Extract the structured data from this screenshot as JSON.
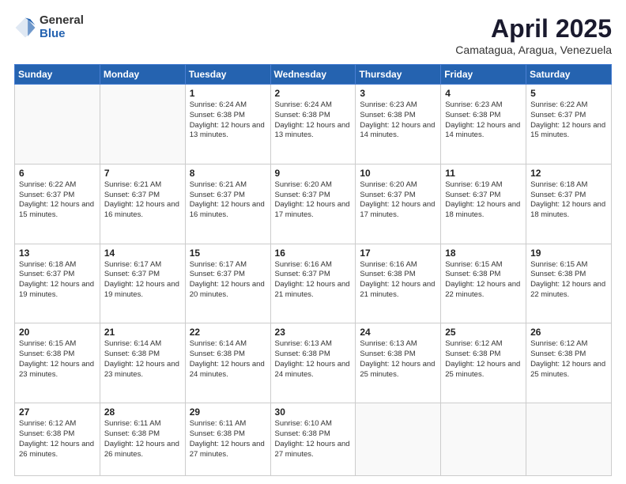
{
  "logo": {
    "general": "General",
    "blue": "Blue"
  },
  "header": {
    "title": "April 2025",
    "subtitle": "Camatagua, Aragua, Venezuela"
  },
  "weekdays": [
    "Sunday",
    "Monday",
    "Tuesday",
    "Wednesday",
    "Thursday",
    "Friday",
    "Saturday"
  ],
  "days": [
    {
      "num": "",
      "info": "",
      "empty": true
    },
    {
      "num": "",
      "info": "",
      "empty": true
    },
    {
      "num": "1",
      "sunrise": "6:24 AM",
      "sunset": "6:38 PM",
      "daylight": "12 hours and 13 minutes."
    },
    {
      "num": "2",
      "sunrise": "6:24 AM",
      "sunset": "6:38 PM",
      "daylight": "12 hours and 13 minutes."
    },
    {
      "num": "3",
      "sunrise": "6:23 AM",
      "sunset": "6:38 PM",
      "daylight": "12 hours and 14 minutes."
    },
    {
      "num": "4",
      "sunrise": "6:23 AM",
      "sunset": "6:38 PM",
      "daylight": "12 hours and 14 minutes."
    },
    {
      "num": "5",
      "sunrise": "6:22 AM",
      "sunset": "6:37 PM",
      "daylight": "12 hours and 15 minutes."
    },
    {
      "num": "6",
      "sunrise": "6:22 AM",
      "sunset": "6:37 PM",
      "daylight": "12 hours and 15 minutes."
    },
    {
      "num": "7",
      "sunrise": "6:21 AM",
      "sunset": "6:37 PM",
      "daylight": "12 hours and 16 minutes."
    },
    {
      "num": "8",
      "sunrise": "6:21 AM",
      "sunset": "6:37 PM",
      "daylight": "12 hours and 16 minutes."
    },
    {
      "num": "9",
      "sunrise": "6:20 AM",
      "sunset": "6:37 PM",
      "daylight": "12 hours and 17 minutes."
    },
    {
      "num": "10",
      "sunrise": "6:20 AM",
      "sunset": "6:37 PM",
      "daylight": "12 hours and 17 minutes."
    },
    {
      "num": "11",
      "sunrise": "6:19 AM",
      "sunset": "6:37 PM",
      "daylight": "12 hours and 18 minutes."
    },
    {
      "num": "12",
      "sunrise": "6:18 AM",
      "sunset": "6:37 PM",
      "daylight": "12 hours and 18 minutes."
    },
    {
      "num": "13",
      "sunrise": "6:18 AM",
      "sunset": "6:37 PM",
      "daylight": "12 hours and 19 minutes."
    },
    {
      "num": "14",
      "sunrise": "6:17 AM",
      "sunset": "6:37 PM",
      "daylight": "12 hours and 19 minutes."
    },
    {
      "num": "15",
      "sunrise": "6:17 AM",
      "sunset": "6:37 PM",
      "daylight": "12 hours and 20 minutes."
    },
    {
      "num": "16",
      "sunrise": "6:16 AM",
      "sunset": "6:37 PM",
      "daylight": "12 hours and 21 minutes."
    },
    {
      "num": "17",
      "sunrise": "6:16 AM",
      "sunset": "6:38 PM",
      "daylight": "12 hours and 21 minutes."
    },
    {
      "num": "18",
      "sunrise": "6:15 AM",
      "sunset": "6:38 PM",
      "daylight": "12 hours and 22 minutes."
    },
    {
      "num": "19",
      "sunrise": "6:15 AM",
      "sunset": "6:38 PM",
      "daylight": "12 hours and 22 minutes."
    },
    {
      "num": "20",
      "sunrise": "6:15 AM",
      "sunset": "6:38 PM",
      "daylight": "12 hours and 23 minutes."
    },
    {
      "num": "21",
      "sunrise": "6:14 AM",
      "sunset": "6:38 PM",
      "daylight": "12 hours and 23 minutes."
    },
    {
      "num": "22",
      "sunrise": "6:14 AM",
      "sunset": "6:38 PM",
      "daylight": "12 hours and 24 minutes."
    },
    {
      "num": "23",
      "sunrise": "6:13 AM",
      "sunset": "6:38 PM",
      "daylight": "12 hours and 24 minutes."
    },
    {
      "num": "24",
      "sunrise": "6:13 AM",
      "sunset": "6:38 PM",
      "daylight": "12 hours and 25 minutes."
    },
    {
      "num": "25",
      "sunrise": "6:12 AM",
      "sunset": "6:38 PM",
      "daylight": "12 hours and 25 minutes."
    },
    {
      "num": "26",
      "sunrise": "6:12 AM",
      "sunset": "6:38 PM",
      "daylight": "12 hours and 25 minutes."
    },
    {
      "num": "27",
      "sunrise": "6:12 AM",
      "sunset": "6:38 PM",
      "daylight": "12 hours and 26 minutes."
    },
    {
      "num": "28",
      "sunrise": "6:11 AM",
      "sunset": "6:38 PM",
      "daylight": "12 hours and 26 minutes."
    },
    {
      "num": "29",
      "sunrise": "6:11 AM",
      "sunset": "6:38 PM",
      "daylight": "12 hours and 27 minutes."
    },
    {
      "num": "30",
      "sunrise": "6:10 AM",
      "sunset": "6:38 PM",
      "daylight": "12 hours and 27 minutes."
    },
    {
      "num": "",
      "info": "",
      "empty": true
    },
    {
      "num": "",
      "info": "",
      "empty": true
    },
    {
      "num": "",
      "info": "",
      "empty": true
    }
  ]
}
